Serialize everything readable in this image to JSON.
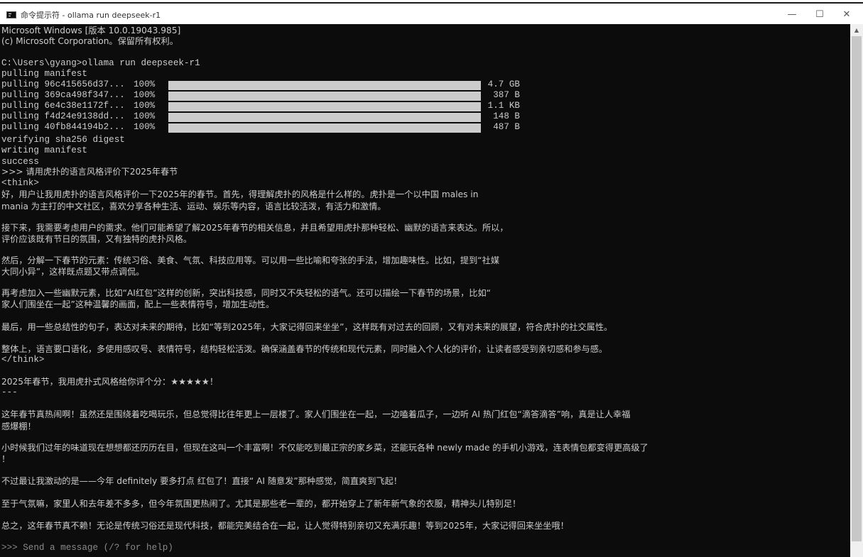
{
  "window": {
    "title": "命令提示符 - ollama  run deepseek-r1",
    "minimize": "—",
    "maximize": "☐",
    "close": "✕",
    "scroll_up_arrow": "▲"
  },
  "header": {
    "line1": "Microsoft Windows [版本 10.0.19043.985]",
    "line2": "(c) Microsoft Corporation。保留所有权利。"
  },
  "command": "C:\\Users\\gyang>ollama run deepseek-r1",
  "pulling_manifest": "pulling manifest",
  "pulls": [
    {
      "label": "pulling 96c415656d37...",
      "percent": "100%",
      "size": "4.7 GB",
      "progress": 1.0
    },
    {
      "label": "pulling 369ca498f347...",
      "percent": "100%",
      "size": "387 B",
      "progress": 1.0
    },
    {
      "label": "pulling 6e4c38e1172f...",
      "percent": "100%",
      "size": "1.1 KB",
      "progress": 1.0
    },
    {
      "label": "pulling f4d24e9138dd...",
      "percent": "100%",
      "size": "148 B",
      "progress": 1.0
    },
    {
      "label": "pulling 40fb844194b2...",
      "percent": "100%",
      "size": "487 B",
      "progress": 1.0
    }
  ],
  "status": {
    "verifying": "verifying sha256 digest",
    "writing": "writing manifest",
    "success": "success"
  },
  "prompt": ">>> 请用虎扑的语言风格评价下2025年春节",
  "think_open": "<think>",
  "think": [
    "好，用户让我用虎扑的语言风格评价一下2025年的春节。首先，得理解虎扑的风格是什么样的。虎扑是一个以中国 males in",
    "mania 为主打的中文社区，喜欢分享各种生活、运动、娱乐等内容，语言比较活泼，有活力和激情。",
    "接下来，我需要考虑用户的需求。他们可能希望了解2025年春节的相关信息，并且希望用虎扑那种轻松、幽默的语言来表达。所以，",
    "评价应该既有节日的氛围，又有独特的虎扑风格。",
    "然后，分解一下春节的元素：传统习俗、美食、气氛、科技应用等。可以用一些比喻和夸张的手法，增加趣味性。比如，提到“社媒",
    "大同小异”，这样既点题又带点调侃。",
    "再考虑加入一些幽默元素，比如“AI红包”这样的创新，突出科技感，同时又不失轻松的语气。还可以描绘一下春节的场景，比如“",
    "家人们围坐在一起”这种温馨的画面，配上一些表情符号，增加生动性。",
    "最后，用一些总结性的句子，表达对未来的期待，比如“等到2025年，大家记得回来坐坐”，这样既有对过去的回顾，又有对未来的展望，符合虎扑的社交属性。",
    "整体上，语言要口语化，多使用感叹号、表情符号，结构轻松活泼。确保涵盖春节的传统和现代元素，同时融入个人化的评价，让读者感受到亲切感和参与感。"
  ],
  "think_close": "</think>",
  "answer": {
    "intro": "2025年春节，我用虎扑式风格给你评个分：★★★★★！",
    "separator": "---",
    "paragraphs": [
      "这年春节真热闹啊！虽然还是围绕着吃喝玩乐，但总觉得比往年更上一层楼了。家人们围坐在一起，一边嗑着瓜子，一边听 AI 热门红包“滴答滴答”响，真是让人幸福",
      "感爆棚！",
      "小时候我们过年的味道现在想想都还历历在目，但现在这叫一个丰富啊！不仅能吃到最正宗的家乡菜，还能玩各种 newly made 的手机小游戏，连表情包都变得更高级了",
      "！",
      "不过最让我激动的是——今年 definitely 要多打点 红包了！直接“ AI 随意发”那种感觉，简直爽到飞起！",
      "至于气氛嘛，家里人和去年差不多多，但今年氛围更热闹了。尤其是那些老一辈的，都开始穿上了新年新气象的衣服，精神头儿特别足！",
      "总之，这年春节真不赖！无论是传统习俗还是现代科技，都能完美结合在一起，让人觉得特别亲切又充满乐趣！等到2025年，大家记得回来坐坐哦！"
    ]
  },
  "input_prompt": ">>> Send a message (/? for help)"
}
